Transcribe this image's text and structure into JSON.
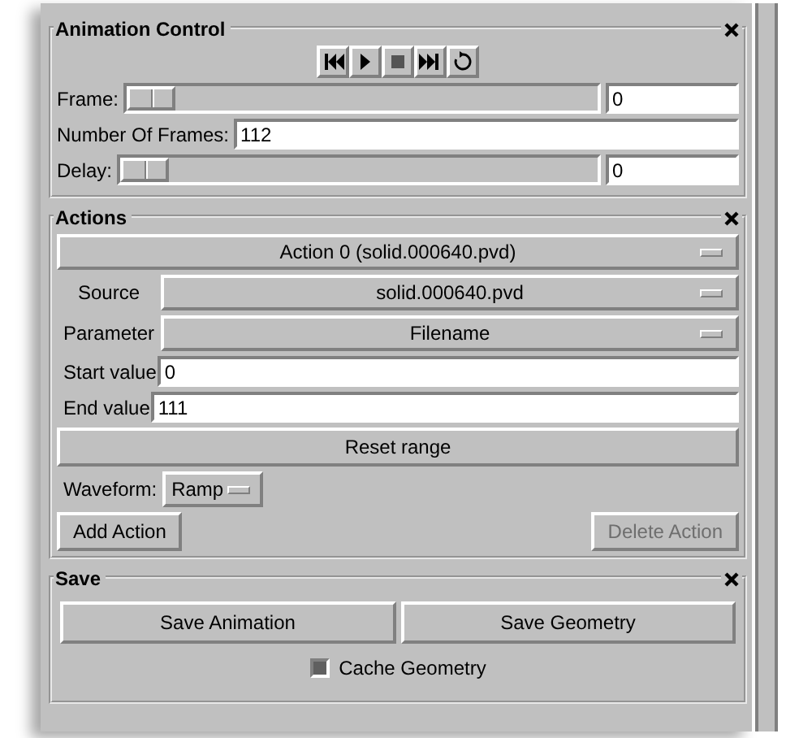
{
  "animation_control": {
    "title": "Animation Control",
    "playback_buttons": [
      {
        "kind": "first"
      },
      {
        "kind": "play"
      },
      {
        "kind": "stop"
      },
      {
        "kind": "last"
      },
      {
        "kind": "loop"
      }
    ],
    "frame": {
      "label": "Frame:",
      "level": 0,
      "value": "0"
    },
    "number_of_frames": {
      "label": "Number Of Frames:",
      "value": "112"
    },
    "delay": {
      "label": "Delay:",
      "level": 0,
      "value": "0"
    }
  },
  "actions": {
    "title": "Actions",
    "action_menu": "Action 0 (solid.000640.pvd)",
    "rows": [
      {
        "kind": "menu",
        "label": "Source",
        "value": "solid.000640.pvd"
      },
      {
        "kind": "menu",
        "label": "Parameter",
        "value": "Filename"
      },
      {
        "kind": "entry",
        "label": "Start value",
        "value": "0"
      },
      {
        "kind": "entry",
        "label": "End value",
        "value": "111"
      }
    ],
    "reset_button": "Reset range",
    "waveform": {
      "label": "Waveform:",
      "value": "Ramp"
    },
    "add_button": {
      "label": "Add Action",
      "disabled": false
    },
    "delete_button": {
      "label": "Delete Action",
      "disabled": true
    }
  },
  "save": {
    "title": "Save",
    "buttons": [
      "Save Animation",
      "Save Geometry"
    ],
    "cache_geometry": {
      "label": "Cache Geometry",
      "checked": true
    }
  }
}
